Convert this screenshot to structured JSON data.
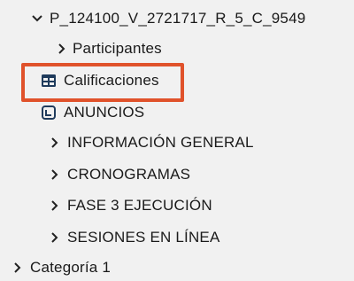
{
  "course": {
    "name": "P_124100_V_2721717_R_5_C_9549",
    "items": [
      {
        "label": "Participantes",
        "icon": "chevron-right-icon"
      },
      {
        "label": "Calificaciones",
        "icon": "grid-table-icon"
      },
      {
        "label": "ANUNCIOS",
        "icon": "announcement-icon"
      },
      {
        "label": "INFORMACIÓN GENERAL",
        "icon": "chevron-right-icon"
      },
      {
        "label": "CRONOGRAMAS",
        "icon": "chevron-right-icon"
      },
      {
        "label": "FASE 3 EJECUCIÓN",
        "icon": "chevron-right-icon"
      },
      {
        "label": "SESIONES EN LÍNEA",
        "icon": "chevron-right-icon"
      }
    ]
  },
  "category": {
    "label": "Categoría 1"
  },
  "colors": {
    "highlight": "#e0522b",
    "background": "#f1f1f1",
    "icon": "#1f3b5c"
  }
}
